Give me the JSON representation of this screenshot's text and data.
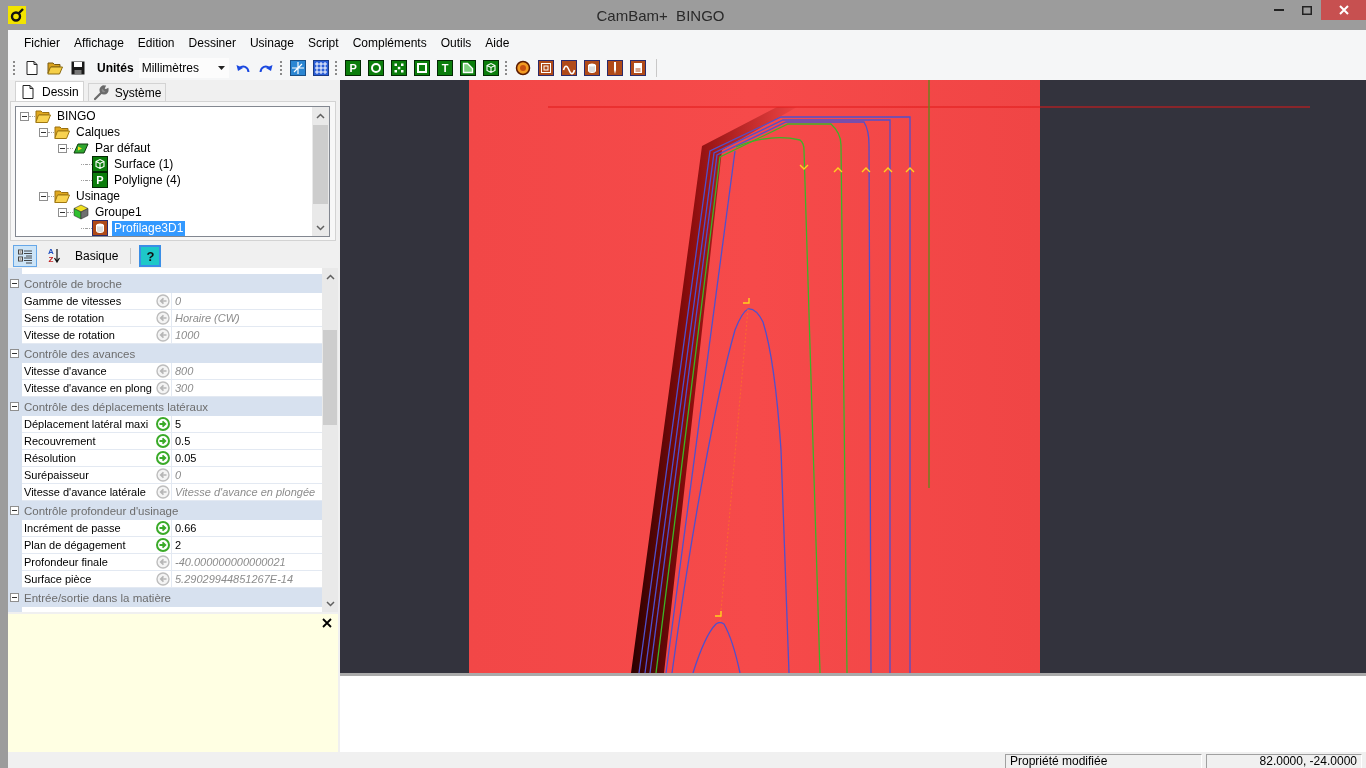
{
  "window": {
    "title": "CamBam+  BINGO"
  },
  "menu": [
    "Fichier",
    "Affichage",
    "Edition",
    "Dessiner",
    "Usinage",
    "Script",
    "Compléments",
    "Outils",
    "Aide"
  ],
  "toolbar": {
    "file_tools": [
      {
        "kind": "new"
      },
      {
        "kind": "open"
      },
      {
        "kind": "save"
      }
    ],
    "units_label": "Unités",
    "units_value": "Millimètres",
    "history_tools": [
      {
        "kind": "undo"
      },
      {
        "kind": "redo"
      }
    ],
    "view_tools": [
      {
        "kind": "snap"
      },
      {
        "kind": "grid"
      }
    ],
    "draw_tools": [
      {
        "kind": "polyline",
        "glyph": "P"
      },
      {
        "kind": "circle"
      },
      {
        "kind": "points"
      },
      {
        "kind": "rectangle"
      },
      {
        "kind": "text",
        "glyph": "T"
      },
      {
        "kind": "region"
      },
      {
        "kind": "surface"
      }
    ],
    "machining_tools": [
      {
        "kind": "profile"
      },
      {
        "kind": "pocket"
      },
      {
        "kind": "engrave"
      },
      {
        "kind": "drill"
      },
      {
        "kind": "lathe"
      },
      {
        "kind": "nc"
      }
    ]
  },
  "side_tabs": [
    {
      "label": "Dessin",
      "kind": "page",
      "selected": true
    },
    {
      "label": "Système",
      "kind": "wrench",
      "selected": false
    }
  ],
  "tree": {
    "nodes": [
      {
        "label": "BINGO",
        "kind": "folder",
        "expanded": true,
        "selected": false,
        "children": [
          {
            "label": "Calques",
            "kind": "folder",
            "expanded": true,
            "selected": false,
            "children": [
              {
                "label": "Par défaut",
                "kind": "layer",
                "expanded": true,
                "selected": false,
                "children": [
                  {
                    "label": "Surface (1)",
                    "kind": "surface",
                    "selected": false
                  },
                  {
                    "label": "Polyligne (4)",
                    "kind": "polyline",
                    "glyph": "P",
                    "selected": false
                  }
                ]
              }
            ]
          },
          {
            "label": "Usinage",
            "kind": "folder",
            "expanded": true,
            "selected": false,
            "children": [
              {
                "label": "Groupe1",
                "kind": "group",
                "expanded": true,
                "selected": false,
                "children": [
                  {
                    "label": "Profilage3D1",
                    "kind": "operation",
                    "selected": true
                  }
                ]
              }
            ]
          }
        ]
      }
    ]
  },
  "properties": {
    "view_buttons": [
      {
        "kind": "categorized",
        "selected": true
      },
      {
        "kind": "alphabetical",
        "glyph_top": "A",
        "glyph_bottom": "Z",
        "selected": false
      }
    ],
    "mode_button": "Basique",
    "help_button": {
      "glyph": "?",
      "selected": true
    },
    "categories": [
      {
        "name": "Contrôle de broche",
        "expanded": true,
        "rows": [
          {
            "name": "Gamme de vitesses",
            "value": "0",
            "modified": false
          },
          {
            "name": "Sens de rotation",
            "value": "Horaire (CW)",
            "modified": false
          },
          {
            "name": "Vitesse de rotation",
            "value": "1000",
            "modified": false
          }
        ]
      },
      {
        "name": "Contrôle des avances",
        "expanded": true,
        "rows": [
          {
            "name": "Vitesse d'avance",
            "value": "800",
            "modified": false
          },
          {
            "name": "Vitesse d'avance en plong",
            "value": "300",
            "modified": false
          }
        ]
      },
      {
        "name": "Contrôle des déplacements latéraux",
        "expanded": true,
        "rows": [
          {
            "name": "Déplacement latéral maxi",
            "value": "5",
            "modified": true
          },
          {
            "name": "Recouvrement",
            "value": "0.5",
            "modified": true
          },
          {
            "name": "Résolution",
            "value": "0.05",
            "modified": true
          },
          {
            "name": "Surépaisseur",
            "value": "0",
            "modified": false
          },
          {
            "name": "Vitesse d'avance latérale",
            "value": "Vitesse d'avance en plongée",
            "modified": false
          }
        ]
      },
      {
        "name": "Contrôle profondeur d'usinage",
        "expanded": true,
        "rows": [
          {
            "name": "Incrément de passe",
            "value": "0.66",
            "modified": true
          },
          {
            "name": "Plan de dégagement",
            "value": "2",
            "modified": true
          },
          {
            "name": "Profondeur finale",
            "value": "-40.000000000000021",
            "modified": false
          },
          {
            "name": "Surface pièce",
            "value": "5.29029944851267E-14",
            "modified": false
          }
        ]
      },
      {
        "name": "Entrée/sortie dans la matière",
        "expanded": true
      }
    ]
  },
  "status_bar": {
    "message": "Propriété modifiée",
    "coordinates": "82.0000, -24.0000"
  }
}
